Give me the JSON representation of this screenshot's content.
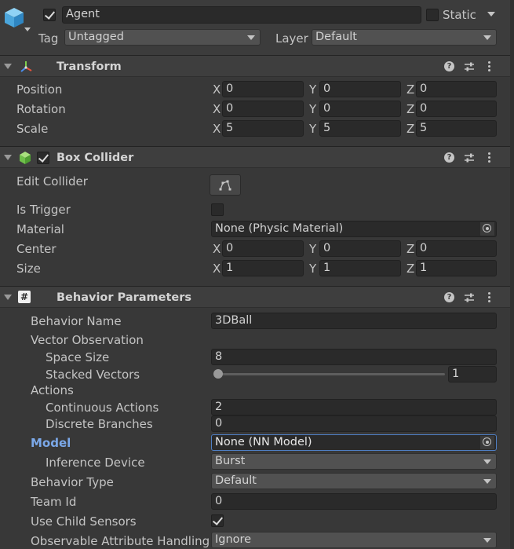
{
  "gameobject": {
    "name": "Agent",
    "active": true,
    "static_label": "Static",
    "static_checked": false,
    "tag_label": "Tag",
    "tag_value": "Untagged",
    "layer_label": "Layer",
    "layer_value": "Default"
  },
  "transform": {
    "title": "Transform",
    "rows": [
      {
        "label": "Position",
        "x": "0",
        "y": "0",
        "z": "0"
      },
      {
        "label": "Rotation",
        "x": "0",
        "y": "0",
        "z": "0"
      },
      {
        "label": "Scale",
        "x": "5",
        "y": "5",
        "z": "5"
      }
    ]
  },
  "box_collider": {
    "title": "Box Collider",
    "enabled": true,
    "edit_collider_label": "Edit Collider",
    "is_trigger_label": "Is Trigger",
    "is_trigger": false,
    "material_label": "Material",
    "material_value": "None (Physic Material)",
    "center_label": "Center",
    "center": {
      "x": "0",
      "y": "0",
      "z": "0"
    },
    "size_label": "Size",
    "size": {
      "x": "1",
      "y": "1",
      "z": "1"
    }
  },
  "behavior": {
    "title": "Behavior Parameters",
    "behavior_name_label": "Behavior Name",
    "behavior_name": "3DBall",
    "vector_observation_label": "Vector Observation",
    "space_size_label": "Space Size",
    "space_size": "8",
    "stacked_vectors_label": "Stacked Vectors",
    "stacked_vectors": "1",
    "stacked_vectors_slider_fraction": 0,
    "actions_label": "Actions",
    "continuous_actions_label": "Continuous Actions",
    "continuous_actions": "2",
    "discrete_branches_label": "Discrete Branches",
    "discrete_branches": "0",
    "model_label": "Model",
    "model_value": "None (NN Model)",
    "inference_device_label": "Inference Device",
    "inference_device": "Burst",
    "behavior_type_label": "Behavior Type",
    "behavior_type": "Default",
    "team_id_label": "Team Id",
    "team_id": "0",
    "use_child_sensors_label": "Use Child Sensors",
    "use_child_sensors": true,
    "observable_attr_label": "Observable Attribute Handling",
    "observable_attr": "Ignore"
  },
  "axes": {
    "x": "X",
    "y": "Y",
    "z": "Z"
  },
  "icons": {
    "gameobject": "cube-icon",
    "transform": "transform-axes-icon",
    "box_collider": "box-collider-icon",
    "behavior": "script-hash-icon",
    "help": "help-icon",
    "presets": "presets-icon",
    "menu": "kebab-menu-icon"
  },
  "colors": {
    "background": "#383838",
    "field": "#2a2a2a",
    "model_label": "#7ba8e8",
    "collider_icon": "#6fc04a",
    "cube_icon": "#5ab0e0"
  }
}
